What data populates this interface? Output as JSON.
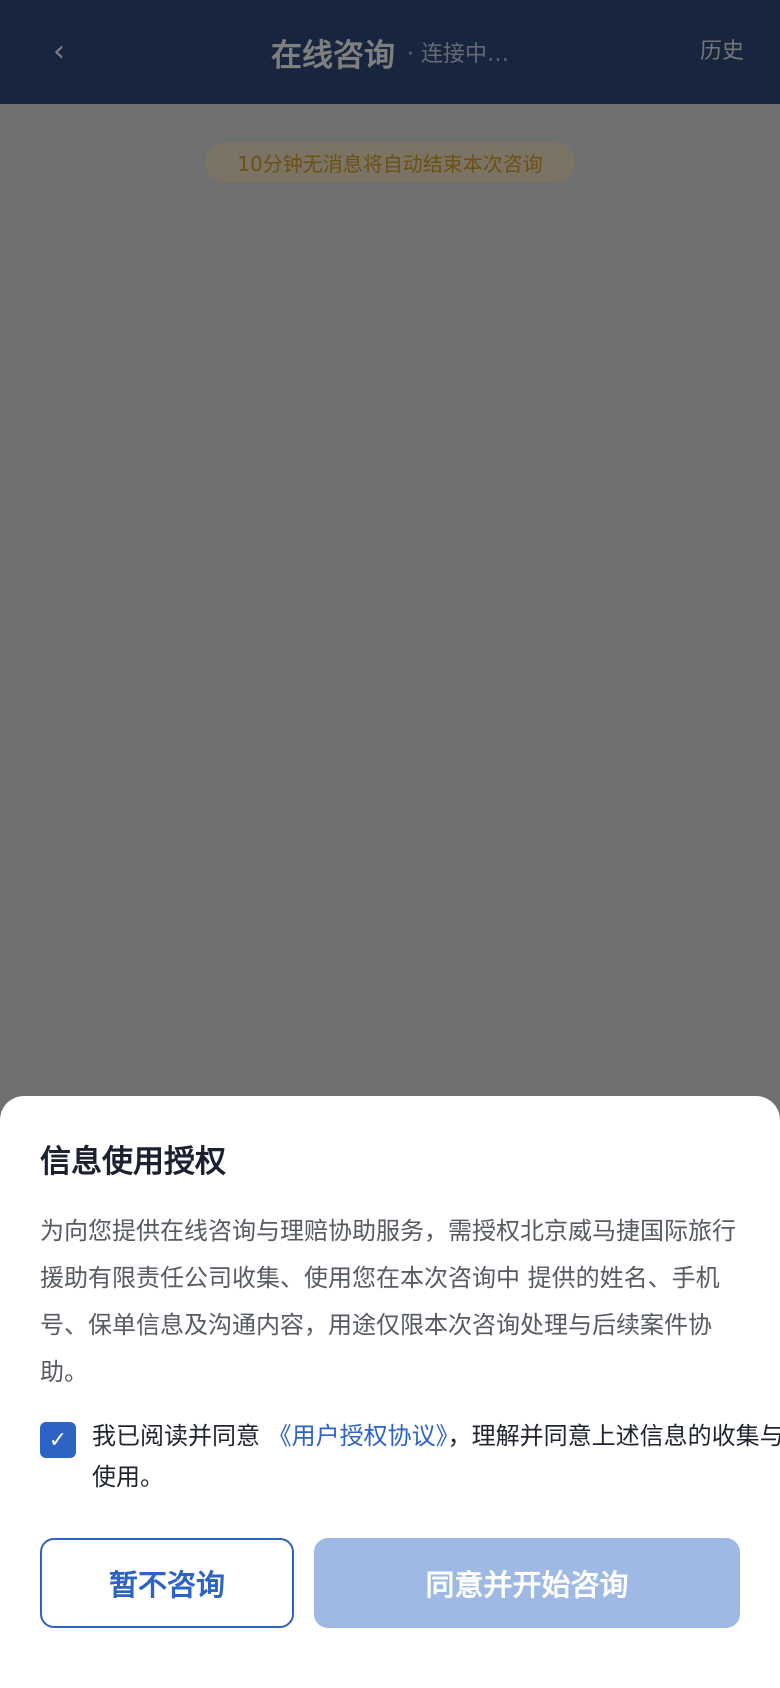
{
  "header": {
    "back_glyph": "‹",
    "title": "在线咨询",
    "status": "· 连接中…",
    "history_label": "历史"
  },
  "chat": {
    "notice": "10分钟无消息将自动结束本次咨询"
  },
  "dialog": {
    "title": "信息使用授权",
    "body": "为向您提供在线咨询与理赔协助服务，需授权北京威马捷国际旅行援助有限责任公司收集、使用您在本次咨询中 提供的姓名、手机号、保单信息及沟通内容，用途仅限本次咨询处理与后续案件协助。",
    "checkbox_checked": true,
    "checkbox_glyph": "✓",
    "agree_prefix": "我已阅读并同意 ",
    "agree_link": "《用户授权协议》",
    "agree_suffix": "，理解并同意上述信息的收集与使用。",
    "decline_label": "暂不咨询",
    "accept_label": "同意并开始咨询"
  },
  "colors": {
    "header_bg": "#2f4a7c",
    "accent": "#2d63c4",
    "accept_disabled": "#9eb9e3",
    "notice_bg": "#f6e6c6",
    "notice_text": "#d9a22d"
  },
  "icons": {
    "back": "chevron-left-icon",
    "checkbox": "checkmark-icon"
  }
}
